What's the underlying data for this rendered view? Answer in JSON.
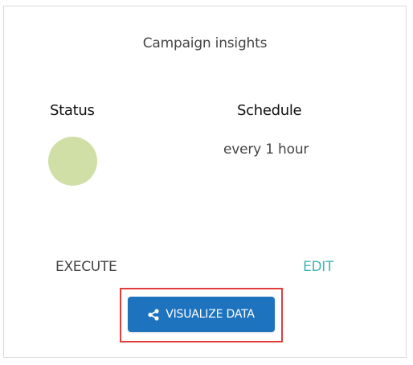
{
  "card": {
    "title": "Campaign insights",
    "status_label": "Status",
    "status_color": "#cfdfa6",
    "schedule_label": "Schedule",
    "schedule_value": "every 1 hour"
  },
  "actions": {
    "execute_label": "EXECUTE",
    "edit_label": "EDIT",
    "edit_color": "#3fb7b2",
    "visualize_label": "VISUALIZE DATA",
    "visualize_icon": "share-icon",
    "visualize_color": "#1e73be"
  },
  "highlight": {
    "color": "#e23c3c"
  }
}
